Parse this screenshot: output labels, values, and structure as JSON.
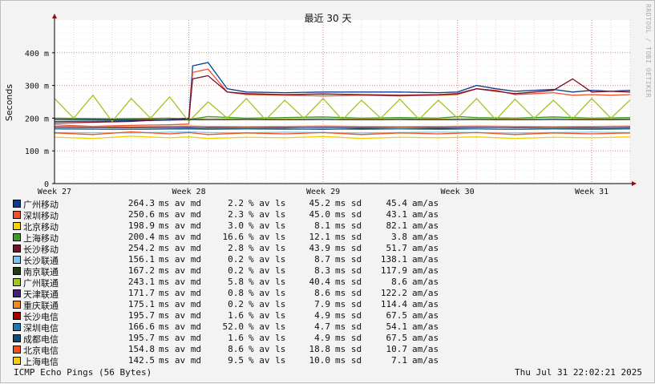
{
  "watermark": "RRDTOOL / TOBI OETIKER",
  "footer": {
    "left": "ICMP Echo Pings (56 Bytes)",
    "right": "Thu Jul 31 22:02:21 2025"
  },
  "legend_units": {
    "avg": "ms av md",
    "loss": "% av ls",
    "sd": "ms sd",
    "amas": "am/as"
  },
  "legend": [
    {
      "name": "广州移动",
      "color": "#0a3d8f",
      "avg": "264.3",
      "loss": "2.2",
      "sd": "45.2",
      "amas": "45.4"
    },
    {
      "name": "深圳移动",
      "color": "#f0502a",
      "avg": "250.6",
      "loss": "2.3",
      "sd": "45.0",
      "amas": "43.1"
    },
    {
      "name": "北京移动",
      "color": "#f5d300",
      "avg": "198.9",
      "loss": "3.0",
      "sd": "8.1",
      "amas": "82.1"
    },
    {
      "name": "上海移动",
      "color": "#3b9c2a",
      "avg": "200.4",
      "loss": "16.6",
      "sd": "12.1",
      "amas": "3.8"
    },
    {
      "name": "长沙移动",
      "color": "#7a0f2a",
      "avg": "254.2",
      "loss": "2.8",
      "sd": "43.9",
      "amas": "51.7"
    },
    {
      "name": "长沙联通",
      "color": "#7cc4f0",
      "avg": "156.1",
      "loss": "0.2",
      "sd": "8.7",
      "amas": "138.1"
    },
    {
      "name": "南京联通",
      "color": "#1f3d0f",
      "avg": "167.2",
      "loss": "0.2",
      "sd": "8.3",
      "amas": "117.9"
    },
    {
      "name": "广州联通",
      "color": "#a4c41a",
      "avg": "243.1",
      "loss": "5.8",
      "sd": "40.4",
      "amas": "8.6"
    },
    {
      "name": "天津联通",
      "color": "#4a1f7a",
      "avg": "171.7",
      "loss": "0.8",
      "sd": "8.6",
      "amas": "122.2"
    },
    {
      "name": "重庆联通",
      "color": "#f08a1a",
      "avg": "175.1",
      "loss": "0.2",
      "sd": "7.9",
      "amas": "114.4"
    },
    {
      "name": "长沙电信",
      "color": "#a00000",
      "avg": "195.7",
      "loss": "1.6",
      "sd": "4.9",
      "amas": "67.5"
    },
    {
      "name": "深圳电信",
      "color": "#1a7ab8",
      "avg": "166.6",
      "loss": "52.0",
      "sd": "4.7",
      "amas": "54.1"
    },
    {
      "name": "成都电信",
      "color": "#0a4f7a",
      "avg": "195.7",
      "loss": "1.6",
      "sd": "4.9",
      "amas": "67.5"
    },
    {
      "name": "北京电信",
      "color": "#f0501a",
      "avg": "154.8",
      "loss": "8.6",
      "sd": "18.8",
      "amas": "10.7"
    },
    {
      "name": "上海电信",
      "color": "#f5d000",
      "avg": "142.5",
      "loss": "9.5",
      "sd": "10.0",
      "amas": "7.1"
    }
  ],
  "chart_data": {
    "type": "line",
    "title": "最近 30 天",
    "ylabel": "Seconds",
    "xlabel": "",
    "ylim": [
      0,
      500
    ],
    "yticks": [
      0,
      100,
      200,
      300,
      400
    ],
    "ytick_labels": [
      "0",
      "100 m",
      "200 m",
      "300 m",
      "400 m"
    ],
    "xlim": [
      0,
      30
    ],
    "xticks": [
      0,
      7,
      14,
      21,
      28
    ],
    "xtick_labels": [
      "Week 27",
      "Week 28",
      "Week 29",
      "Week 30",
      "Week 31"
    ],
    "grid": true,
    "series": [
      {
        "name": "广州移动",
        "color": "#0a3d8f",
        "x": [
          0,
          4,
          7,
          7.2,
          8,
          9,
          10,
          12,
          14,
          16,
          18,
          20,
          21,
          22,
          23,
          24,
          25,
          26,
          27,
          28,
          29,
          30
        ],
        "y": [
          190,
          192,
          195,
          360,
          370,
          290,
          280,
          278,
          280,
          280,
          280,
          278,
          280,
          300,
          290,
          282,
          285,
          288,
          280,
          285,
          282,
          285
        ]
      },
      {
        "name": "深圳移动",
        "color": "#f0502a",
        "x": [
          0,
          2,
          4,
          6,
          7,
          7.2,
          8,
          9,
          10,
          12,
          14,
          16,
          18,
          20,
          21,
          22,
          23,
          24,
          25,
          26,
          27,
          28,
          29,
          30
        ],
        "y": [
          180,
          175,
          178,
          180,
          182,
          340,
          350,
          280,
          272,
          270,
          268,
          270,
          268,
          270,
          272,
          290,
          285,
          272,
          275,
          278,
          270,
          272,
          270,
          272
        ]
      },
      {
        "name": "北京移动",
        "color": "#f5d300",
        "x": [
          0,
          3,
          6,
          7,
          8,
          10,
          12,
          14,
          16,
          18,
          20,
          21,
          22,
          24,
          26,
          28,
          30
        ],
        "y": [
          198,
          195,
          200,
          198,
          200,
          198,
          199,
          200,
          198,
          199,
          198,
          200,
          198,
          199,
          200,
          198,
          199
        ]
      },
      {
        "name": "上海移动",
        "color": "#3b9c2a",
        "x": [
          0,
          3,
          6,
          7,
          8,
          10,
          12,
          14,
          16,
          18,
          20,
          21,
          22,
          24,
          26,
          28,
          30
        ],
        "y": [
          200,
          198,
          200,
          196,
          205,
          200,
          202,
          204,
          200,
          202,
          200,
          205,
          202,
          200,
          204,
          200,
          202
        ]
      },
      {
        "name": "长沙移动",
        "color": "#7a0f2a",
        "x": [
          0,
          4,
          7,
          7.2,
          8,
          9,
          10,
          12,
          14,
          16,
          18,
          20,
          21,
          22,
          24,
          25,
          26,
          27,
          28,
          29,
          30
        ],
        "y": [
          185,
          190,
          200,
          320,
          330,
          280,
          275,
          272,
          274,
          272,
          270,
          272,
          275,
          290,
          275,
          280,
          285,
          320,
          280,
          282,
          280
        ]
      },
      {
        "name": "长沙联通",
        "color": "#7cc4f0",
        "x": [
          0,
          4,
          7,
          8,
          10,
          12,
          14,
          16,
          18,
          20,
          22,
          24,
          26,
          28,
          30
        ],
        "y": [
          156,
          155,
          158,
          156,
          155,
          157,
          156,
          155,
          156,
          157,
          156,
          155,
          156,
          157,
          156
        ]
      },
      {
        "name": "南京联通",
        "color": "#1f3d0f",
        "x": [
          0,
          4,
          7,
          8,
          10,
          12,
          14,
          16,
          18,
          20,
          22,
          24,
          26,
          28,
          30
        ],
        "y": [
          167,
          166,
          168,
          167,
          168,
          167,
          166,
          168,
          167,
          168,
          167,
          166,
          168,
          167,
          168
        ]
      },
      {
        "name": "广州联通",
        "color": "#a4c41a",
        "x": [
          0,
          1,
          2,
          3,
          4,
          5,
          6,
          7,
          8,
          9,
          10,
          11,
          12,
          13,
          14,
          15,
          16,
          17,
          18,
          19,
          20,
          21,
          22,
          23,
          24,
          25,
          26,
          27,
          28,
          29,
          30
        ],
        "y": [
          260,
          200,
          270,
          190,
          260,
          200,
          265,
          190,
          250,
          200,
          260,
          195,
          255,
          200,
          260,
          195,
          255,
          200,
          258,
          196,
          255,
          200,
          260,
          195,
          258,
          200,
          255,
          198,
          260,
          200,
          256
        ]
      },
      {
        "name": "天津联通",
        "color": "#4a1f7a",
        "x": [
          0,
          4,
          7,
          8,
          10,
          12,
          14,
          16,
          18,
          20,
          22,
          24,
          26,
          28,
          30
        ],
        "y": [
          172,
          171,
          172,
          171,
          172,
          171,
          172,
          171,
          172,
          171,
          172,
          171,
          172,
          171,
          172
        ]
      },
      {
        "name": "重庆联通",
        "color": "#f08a1a",
        "x": [
          0,
          4,
          7,
          8,
          10,
          12,
          14,
          16,
          18,
          20,
          22,
          24,
          26,
          28,
          30
        ],
        "y": [
          175,
          174,
          176,
          175,
          174,
          175,
          176,
          175,
          174,
          175,
          176,
          175,
          174,
          175,
          176
        ]
      },
      {
        "name": "长沙电信",
        "color": "#a00000",
        "x": [
          0,
          4,
          7,
          8,
          10,
          12,
          14,
          16,
          18,
          20,
          22,
          24,
          26,
          28,
          30
        ],
        "y": [
          196,
          195,
          196,
          195,
          196,
          195,
          196,
          195,
          196,
          195,
          196,
          195,
          196,
          195,
          196
        ]
      },
      {
        "name": "深圳电信",
        "color": "#1a7ab8",
        "x": [
          0,
          4,
          7,
          8,
          10,
          12,
          14,
          16,
          18,
          20,
          22,
          24,
          26,
          28,
          30
        ],
        "y": [
          167,
          166,
          167,
          166,
          167,
          166,
          167,
          166,
          167,
          166,
          167,
          166,
          167,
          166,
          167
        ]
      },
      {
        "name": "成都电信",
        "color": "#0a4f7a",
        "x": [
          0,
          4,
          7,
          8,
          10,
          12,
          14,
          16,
          18,
          20,
          22,
          24,
          26,
          28,
          30
        ],
        "y": [
          196,
          195,
          196,
          195,
          196,
          195,
          196,
          195,
          196,
          195,
          196,
          195,
          196,
          195,
          196
        ]
      },
      {
        "name": "北京电信",
        "color": "#f0501a",
        "x": [
          0,
          2,
          4,
          6,
          7,
          8,
          10,
          12,
          14,
          16,
          18,
          20,
          22,
          24,
          26,
          28,
          30
        ],
        "y": [
          155,
          150,
          158,
          152,
          156,
          150,
          155,
          152,
          156,
          150,
          155,
          152,
          156,
          150,
          155,
          152,
          155
        ]
      },
      {
        "name": "上海电信",
        "color": "#f5d000",
        "x": [
          0,
          2,
          4,
          6,
          7,
          8,
          10,
          12,
          14,
          16,
          18,
          20,
          22,
          24,
          26,
          28,
          30
        ],
        "y": [
          142,
          138,
          145,
          140,
          143,
          138,
          142,
          140,
          144,
          138,
          142,
          140,
          143,
          138,
          142,
          140,
          143
        ]
      }
    ]
  }
}
